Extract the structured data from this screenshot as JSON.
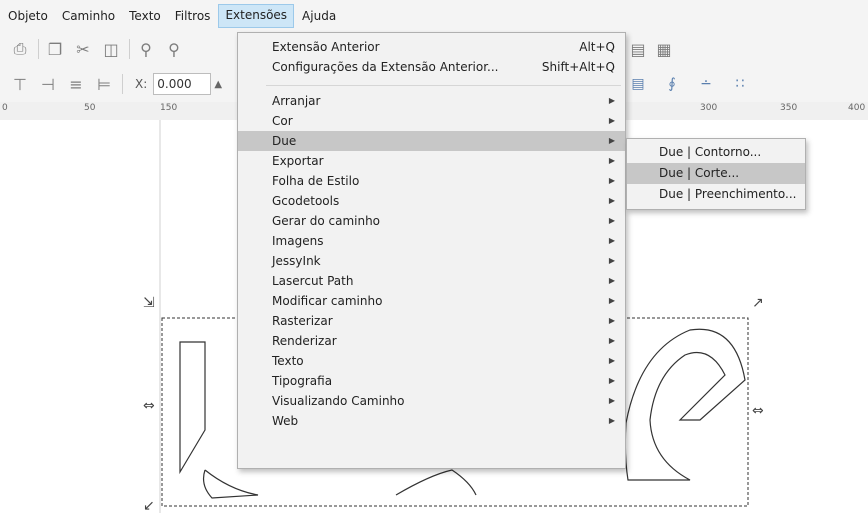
{
  "menubar": {
    "items": [
      "Objeto",
      "Caminho",
      "Texto",
      "Filtros",
      "Extensões",
      "Ajuda"
    ],
    "active_index": 4
  },
  "toolbar": {
    "x_label": "X:",
    "x_value": "0.000"
  },
  "ruler": {
    "labels": [
      "0",
      "50",
      "150",
      "300",
      "350",
      "400"
    ]
  },
  "extensions_menu": {
    "items": [
      {
        "label": "Extensão Anterior",
        "shortcut": "Alt+Q"
      },
      {
        "label": "Configurações da Extensão Anterior...",
        "shortcut": "Shift+Alt+Q"
      },
      {
        "label": "Arranjar",
        "submenu": true
      },
      {
        "label": "Cor",
        "submenu": true
      },
      {
        "label": "Due",
        "submenu": true,
        "highlighted": true
      },
      {
        "label": "Exportar",
        "submenu": true
      },
      {
        "label": "Folha de Estilo",
        "submenu": true
      },
      {
        "label": "Gcodetools",
        "submenu": true
      },
      {
        "label": "Gerar do caminho",
        "submenu": true
      },
      {
        "label": "Imagens",
        "submenu": true
      },
      {
        "label": "JessyInk",
        "submenu": true
      },
      {
        "label": "Lasercut Path",
        "submenu": true
      },
      {
        "label": "Modificar caminho",
        "submenu": true
      },
      {
        "label": "Rasterizar",
        "submenu": true
      },
      {
        "label": "Renderizar",
        "submenu": true
      },
      {
        "label": "Texto",
        "submenu": true
      },
      {
        "label": "Tipografia",
        "submenu": true
      },
      {
        "label": "Visualizando Caminho",
        "submenu": true
      },
      {
        "label": "Web",
        "submenu": true
      }
    ]
  },
  "due_submenu": {
    "items": [
      {
        "label": "Due | Contorno..."
      },
      {
        "label": "Due | Corte...",
        "highlighted": true
      },
      {
        "label": "Due | Preenchimento..."
      }
    ]
  },
  "colors": {
    "menu_bg": "#f2f2f2",
    "highlight": "#c7c7c7",
    "active_menubar": "#cde6f7"
  },
  "icons": [
    "print-icon",
    "copy-icon",
    "cut-icon",
    "paste-icon",
    "zoom-icon",
    "zoom-selection-icon",
    "align-icon"
  ]
}
